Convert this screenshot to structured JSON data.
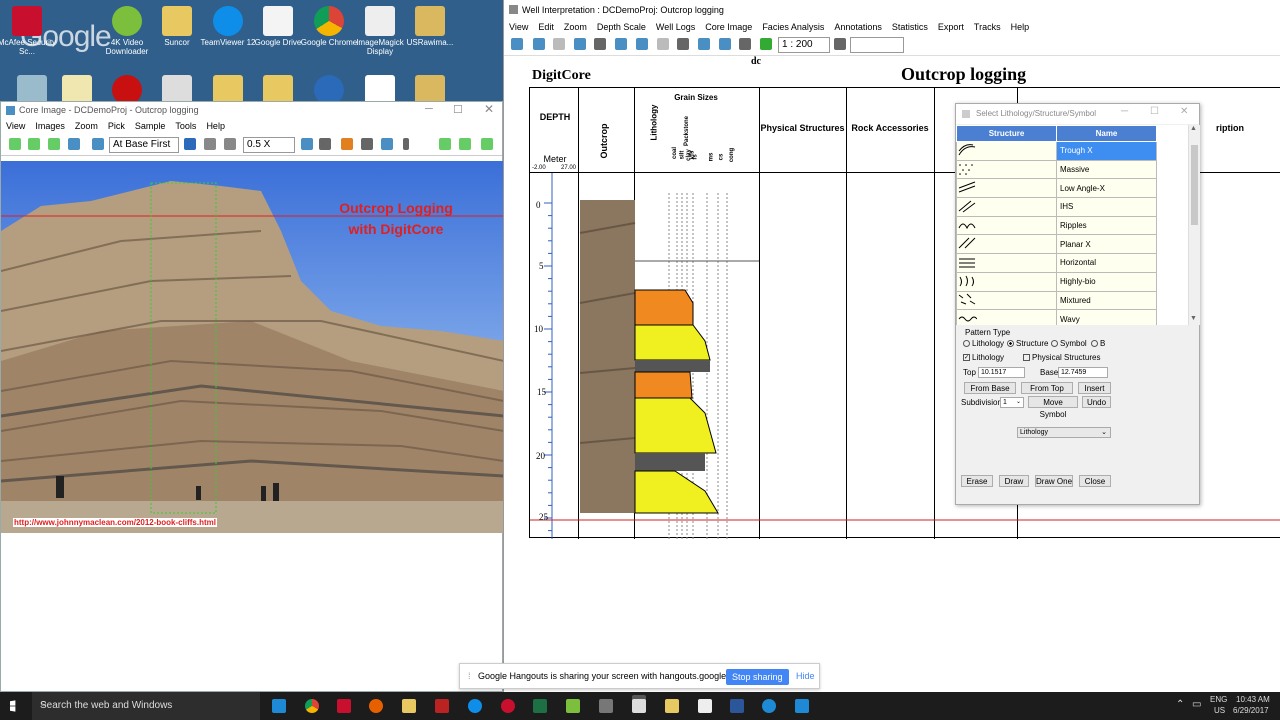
{
  "desktop": {
    "icons_row1": [
      {
        "label": "McAfee Security Sc..."
      },
      {
        "label": "4K Video Downloader"
      },
      {
        "label": "Suncor"
      },
      {
        "label": "TeamViewer 12"
      },
      {
        "label": "Google Drive"
      },
      {
        "label": "Google Chrome"
      },
      {
        "label": "ImageMagick Display"
      },
      {
        "label": "USRawima..."
      }
    ],
    "google_text": "Google"
  },
  "core_window": {
    "title": "Core Image - DCDemoProj - Outcrop logging",
    "menu": [
      "View",
      "Images",
      "Zoom",
      "Pick",
      "Sample",
      "Tools",
      "Help"
    ],
    "toolbar": {
      "position_select": "At Base First",
      "zoom_select": "0.5 X"
    },
    "overlay_title_line1": "Outcrop Logging",
    "overlay_title_line2": "with DigitCore",
    "url": "http://www.johnnymaclean.com/2012-book-cliffs.html"
  },
  "well_window": {
    "title": "Well Interpretation : DCDemoProj: Outcrop logging",
    "menu": [
      "View",
      "Edit",
      "Zoom",
      "Depth Scale",
      "Well Logs",
      "Core Image",
      "Facies Analysis",
      "Annotations",
      "Statistics",
      "Export",
      "Tracks",
      "Help"
    ],
    "scale": "1 : 200",
    "brand": "DigitCore",
    "dc_label": "dc",
    "page_title": "Outcrop logging",
    "headers": {
      "depth": "DEPTH",
      "meter": "Meter",
      "range_left": "-2.00",
      "range_right": "27.00",
      "outcrop": "Outcrop",
      "lithology": "Lithology",
      "grain_sizes": "Grain Sizes",
      "physical": "Physical Structures",
      "rock": "Rock Accessories",
      "description_partial": "ription"
    },
    "grain_labels": [
      "coal",
      "silt",
      "clay",
      "vfs",
      "fs",
      "ms",
      "cs",
      "cong",
      "Packstone"
    ],
    "depth_ticks": [
      "0",
      "5",
      "10",
      "15",
      "20",
      "25"
    ]
  },
  "dialog": {
    "title": "Select Lithology/Structure/Symbol",
    "col_structure": "Structure",
    "col_name": "Name",
    "rows": [
      "Trough X",
      "Massive",
      "Low Angle-X",
      "IHS",
      "Ripples",
      "Planar X",
      "Horizontal",
      "Highly-bio",
      "Mixtured",
      "Wavy"
    ],
    "selected": "Trough X",
    "pattern_type": "Pattern Type",
    "radios": [
      "Lithology",
      "Structure",
      "Symbol",
      "B"
    ],
    "checkboxes": [
      "Lithology",
      "Physical Structures"
    ],
    "top_label": "Top",
    "top_value": "10.1517",
    "base_label": "Base",
    "base_value": "12.7459",
    "btn_from_base": "From Base",
    "btn_from_top": "From Top",
    "btn_insert": "Insert",
    "subdivision_label": "Subdivision",
    "subdivision_value": "1",
    "btn_move": "Move Symbol",
    "btn_undo": "Undo",
    "type_select": "Lithology",
    "btn_erase": "Erase",
    "btn_draw": "Draw",
    "btn_draw_one": "Draw One",
    "btn_close": "Close"
  },
  "hangouts": {
    "message": "Google Hangouts is sharing your screen with hangouts.google.com.",
    "stop": "Stop sharing",
    "hide": "Hide"
  },
  "taskbar": {
    "search": "Search the web and Windows",
    "lang1": "ENG",
    "lang2": "US",
    "time": "10:43 AM",
    "date": "6/29/2017"
  }
}
